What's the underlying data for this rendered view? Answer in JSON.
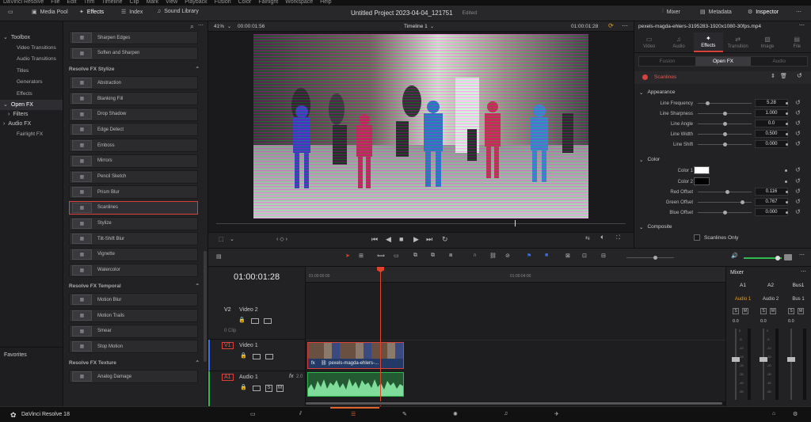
{
  "menu": [
    "DaVinci Resolve",
    "File",
    "Edit",
    "Trim",
    "Timeline",
    "Clip",
    "Mark",
    "View",
    "Playback",
    "Fusion",
    "Color",
    "Fairlight",
    "Workspace",
    "Help"
  ],
  "toolbar": {
    "media_pool": "Media Pool",
    "effects": "Effects",
    "index": "Index",
    "sound_library": "Sound Library",
    "project_title": "Untitled Project 2023-04-04_121751",
    "project_status": "Edited",
    "mixer": "Mixer",
    "metadata": "Metadata",
    "inspector": "Inspector"
  },
  "left_tree": {
    "toolbox": "Toolbox",
    "toolbox_items": [
      "Video Transitions",
      "Audio Transitions",
      "Titles",
      "Generators",
      "Effects"
    ],
    "open_fx": "Open FX",
    "filters": "Filters",
    "audio_fx": "Audio FX",
    "fairlight_fx": "Fairlight FX",
    "favorites": "Favorites"
  },
  "fx_list": {
    "top_items": [
      "Sharpen Edges",
      "Soften and Sharpen"
    ],
    "stylize_header": "Resolve FX Stylize",
    "stylize_items": [
      "Abstraction",
      "Blanking Fill",
      "Drop Shadow",
      "Edge Detect",
      "Emboss",
      "Mirrors",
      "Pencil Sketch",
      "Prism Blur",
      "Scanlines",
      "Stylize",
      "Tilt-Shift Blur",
      "Vignette",
      "Watercolor"
    ],
    "selected": "Scanlines",
    "temporal_header": "Resolve FX Temporal",
    "temporal_items": [
      "Motion Blur",
      "Motion Trails",
      "Smear",
      "Stop Motion"
    ],
    "texture_header": "Resolve FX Texture",
    "texture_items": [
      "Analog Damage"
    ]
  },
  "viewer": {
    "zoom": "41%",
    "timecode_left": "00:00:01:56",
    "timeline_name": "Timeline 1",
    "timecode_right": "01:00:01:28",
    "playhead_fraction": 0.73
  },
  "inspector": {
    "clip_name": "pexels-magda-ehlers-3195283-1920x1080-30fps.mp4",
    "tabs": [
      "Video",
      "Audio",
      "Effects",
      "Transition",
      "Image",
      "File"
    ],
    "active_tab": "Effects",
    "subtabs": [
      "Fusion",
      "Open FX",
      "Audio"
    ],
    "active_subtab": "Open FX",
    "effect_name": "Scanlines",
    "appearance_header": "Appearance",
    "appearance": [
      {
        "label": "Line Frequency",
        "value": "5.28",
        "pos": 0.15
      },
      {
        "label": "Line Sharpness",
        "value": "1.000",
        "pos": 0.5
      },
      {
        "label": "Line Angle",
        "value": "0.0",
        "pos": 0.5
      },
      {
        "label": "Line Width",
        "value": "0.500",
        "pos": 0.5
      },
      {
        "label": "Line Shift",
        "value": "0.000",
        "pos": 0.5
      }
    ],
    "color_header": "Color",
    "color1_label": "Color 1",
    "color1": "#ffffff",
    "color2_label": "Color 2",
    "color2": "#000000",
    "offsets": [
      {
        "label": "Red Offset",
        "value": "0.116",
        "pos": 0.55
      },
      {
        "label": "Green Offset",
        "value": "0.767",
        "pos": 0.85
      },
      {
        "label": "Blue Offset",
        "value": "0.000",
        "pos": 0.5
      }
    ],
    "composite_header": "Composite",
    "scanlines_only": "Scanlines Only"
  },
  "timeline": {
    "timecode": "01:00:01:28",
    "ruler": [
      "01:00:00:00",
      "01:00:04:00"
    ],
    "tracks": [
      {
        "id": "V2",
        "name": "Video 2",
        "sub": "0 Clip"
      },
      {
        "id": "V1",
        "name": "Video 1"
      },
      {
        "id": "A1",
        "name": "Audio 1",
        "level": "2.0"
      }
    ],
    "clip_label": "pexels-magda-ehlers-...",
    "fx_label": "fx",
    "solo": "S",
    "mute": "M"
  },
  "mixer": {
    "title": "Mixer",
    "channels": [
      "A1",
      "A2",
      "Bus1"
    ],
    "channel_names": [
      "Audio 1",
      "Audio 2",
      "Bus 1"
    ],
    "gain": [
      "0.0",
      "0.0",
      "0.0"
    ],
    "scale": [
      "0",
      "-5",
      "-10",
      "-15",
      "-20",
      "-30",
      "-40",
      "-50"
    ]
  },
  "bottom": {
    "app_name": "DaVinci Resolve 18"
  },
  "colors": {
    "accent": "#d9423a",
    "active_page": "#e0632c",
    "bg": "#1c1c1e"
  }
}
